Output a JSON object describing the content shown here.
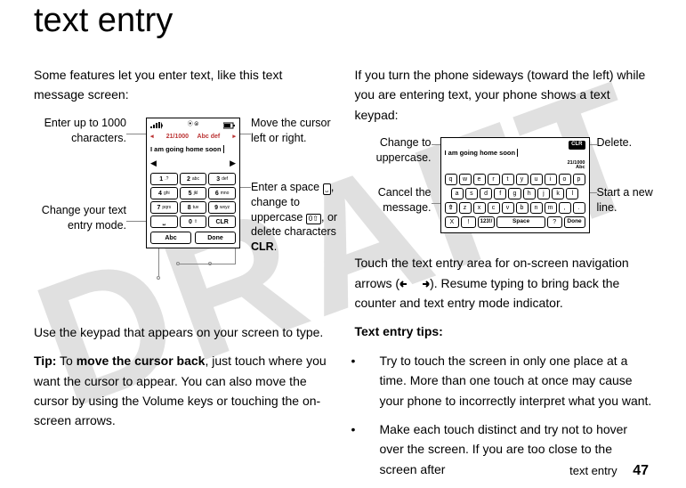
{
  "watermark": "DRAFT",
  "title": "text entry",
  "left": {
    "intro": "Some features let you enter text, like this text message screen:",
    "afterFig": "Use the keypad that appears on your screen to type.",
    "tipLead": "Tip:",
    "tipRest": " To ",
    "tipBold": "move the cursor back",
    "tipTail": ", just touch where you want the cursor to appear. You can also move the cursor by using the Volume keys or touching the on-screen arrows.",
    "callouts": {
      "enterUp": "Enter up to 1000 characters.",
      "changeMode": "Change your text entry mode.",
      "moveCursor": "Move the cursor left or right.",
      "enterSpaceLead": "Enter a space ",
      "change": ", change to uppercase ",
      "orDelete": ", or delete characters ",
      "clr": "CLR",
      "period": "."
    },
    "phone": {
      "counterLeft": "21/1000",
      "counterRight": "Abc def",
      "typed": "I am going home soon",
      "softLeft": "Abc",
      "softRight": "Done",
      "keys": [
        [
          "1",
          ".?"
        ],
        [
          "2",
          "abc"
        ],
        [
          "3",
          "def"
        ],
        [
          "4",
          "ghi"
        ],
        [
          "5",
          "jkl"
        ],
        [
          "6",
          "mno"
        ],
        [
          "7",
          "pqrs"
        ],
        [
          "8",
          "tuv"
        ],
        [
          "9",
          "wxyz"
        ]
      ],
      "space": "⎵",
      "zero": "0",
      "zeroIcon": "⇧",
      "clr": "CLR"
    }
  },
  "right": {
    "intro": "If you turn the phone sideways (toward the left) while you are entering text, your phone shows a text keypad:",
    "afterFig1": "Touch the text entry area for on-screen navigation arrows (",
    "afterFig2": "). Resume typing to bring back the counter and text entry mode indicator.",
    "tipsHead": "Text entry tips:",
    "b1": "Try to touch the screen in only one place at a time. More than one touch at once may cause your phone to incorrectly interpret what you want.",
    "b2": "Make each touch distinct and try not to hover over the screen. If you are too close to the screen after",
    "callouts": {
      "changeUpper": "Change to uppercase.",
      "cancel": "Cancel the message.",
      "delete": "Delete.",
      "startLine": "Start a new line."
    },
    "phone": {
      "typed": "I am going home soon",
      "clr": "CLR",
      "mode1": "21/1000",
      "mode2": "Abc",
      "row1": [
        "q",
        "w",
        "e",
        "r",
        "t",
        "y",
        "u",
        "i",
        "o",
        "p"
      ],
      "row2": [
        "a",
        "s",
        "d",
        "f",
        "g",
        "h",
        "j",
        "k",
        "l"
      ],
      "row3": [
        "⇧",
        "z",
        "x",
        "c",
        "v",
        "b",
        "n",
        "m",
        ",",
        "."
      ],
      "row4": {
        "x": "X",
        "excl": "!",
        "lab": "123!/",
        "space": "Space",
        "q": "?",
        "done": "Done"
      }
    }
  },
  "footer": {
    "label": "text entry",
    "page": "47"
  }
}
